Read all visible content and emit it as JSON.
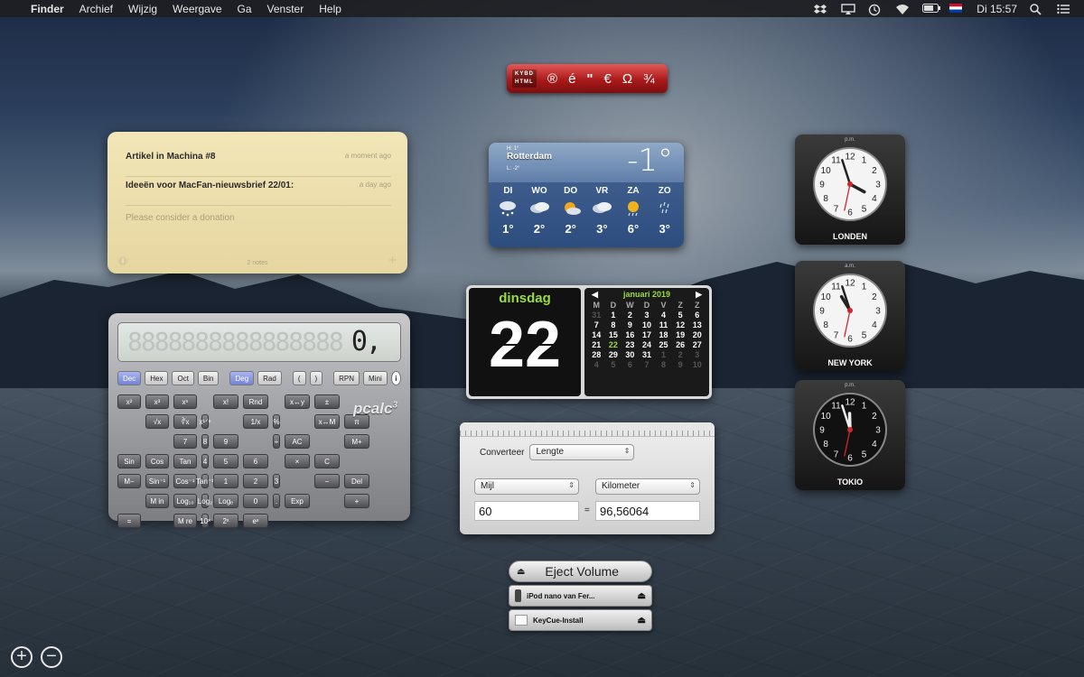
{
  "menubar": {
    "app": "Finder",
    "items": [
      "Archief",
      "Wijzig",
      "Weergave",
      "Ga",
      "Venster",
      "Help"
    ],
    "clock": "Di 15:57",
    "icons": [
      "dropbox-icon",
      "airplay-icon",
      "time-machine-icon",
      "wifi-icon",
      "battery-icon",
      "flag-nl-icon",
      "spotlight-icon",
      "notification-center-icon"
    ]
  },
  "stickies": {
    "notes": [
      {
        "title": "Artikel in Machina #8",
        "age": "a moment ago"
      },
      {
        "title": "Ideeën voor MacFan-nieuwsbrief 22/01:",
        "age": "a day ago"
      }
    ],
    "placeholder": "Please consider a donation",
    "count": "2 notes"
  },
  "calculator": {
    "ghost": "8888888888888888",
    "display": "0,",
    "modes": [
      "Dec",
      "Hex",
      "Oct",
      "Bin",
      "Deg",
      "Rad",
      "(",
      ")",
      "RPN",
      "Mini"
    ],
    "brand": "pcalc",
    "brand_sup": "3",
    "keys": [
      [
        "x²",
        "x³",
        "xⁿ",
        "",
        "x!",
        "Rnd",
        "",
        "x↔y",
        "±",
        ""
      ],
      [
        "√x",
        "∛x",
        "x¹ᐟⁿ",
        "",
        "1/x",
        "%",
        "",
        "x↔M",
        "π",
        ""
      ],
      [
        "7",
        "8",
        "9",
        "",
        "÷",
        "AC",
        "",
        "M+",
        "Sin",
        "Cos",
        "Tan"
      ],
      [
        "4",
        "5",
        "6",
        "",
        "×",
        "C",
        "",
        "M−",
        "Sin⁻¹",
        "Cos⁻¹",
        "Tan⁻¹"
      ],
      [
        "1",
        "2",
        "3",
        "",
        "−",
        "Del",
        "",
        "M in",
        "Log₁₀",
        "Log₂",
        "Logₑ"
      ],
      [
        "0",
        ".",
        "Exp",
        "",
        "+",
        "=",
        "",
        "M re",
        "10ˣ",
        "2ˣ",
        "eˣ"
      ]
    ]
  },
  "keyboard": {
    "labels": [
      "KYBD",
      "HTML"
    ],
    "chars": [
      "®",
      "é",
      "\"",
      "€",
      "Ω",
      "¾"
    ]
  },
  "weather": {
    "city": "Rotterdam",
    "high": "H: 1°",
    "low": "L: -2°",
    "temp": "-1°",
    "days": [
      {
        "d": "DI",
        "t": "1°",
        "icon": "snow-icon"
      },
      {
        "d": "WO",
        "t": "2°",
        "icon": "cloudy-icon"
      },
      {
        "d": "DO",
        "t": "2°",
        "icon": "partly-sunny-icon"
      },
      {
        "d": "VR",
        "t": "3°",
        "icon": "cloudy-icon"
      },
      {
        "d": "ZA",
        "t": "6°",
        "icon": "sun-rain-icon"
      },
      {
        "d": "ZO",
        "t": "3°",
        "icon": "rain-icon"
      }
    ]
  },
  "calendar": {
    "weekday": "dinsdag",
    "day": "22",
    "month": "januari 2019",
    "headers": [
      "M",
      "D",
      "W",
      "D",
      "V",
      "Z",
      "Z"
    ],
    "cells": [
      "31",
      "1",
      "2",
      "3",
      "4",
      "5",
      "6",
      "7",
      "8",
      "9",
      "10",
      "11",
      "12",
      "13",
      "14",
      "15",
      "16",
      "17",
      "18",
      "19",
      "20",
      "21",
      "22",
      "23",
      "24",
      "25",
      "26",
      "27",
      "28",
      "29",
      "30",
      "31",
      "1",
      "2",
      "3",
      "4",
      "5",
      "6",
      "7",
      "8",
      "9",
      "10"
    ],
    "today_index": 22
  },
  "converter": {
    "label": "Converteer",
    "type": "Lengte",
    "from_unit": "Mijl",
    "to_unit": "Kilometer",
    "from_value": "60",
    "equals": "=",
    "to_value": "96,56064"
  },
  "clocks": [
    {
      "city": "LONDEN",
      "ampm": "p.m."
    },
    {
      "city": "NEW YORK",
      "ampm": "a.m."
    },
    {
      "city": "TOKIO",
      "ampm": "p.m."
    }
  ],
  "eject": {
    "title": "Eject Volume",
    "volumes": [
      "iPod nano van Fer...",
      "KeyCue-Install"
    ]
  }
}
